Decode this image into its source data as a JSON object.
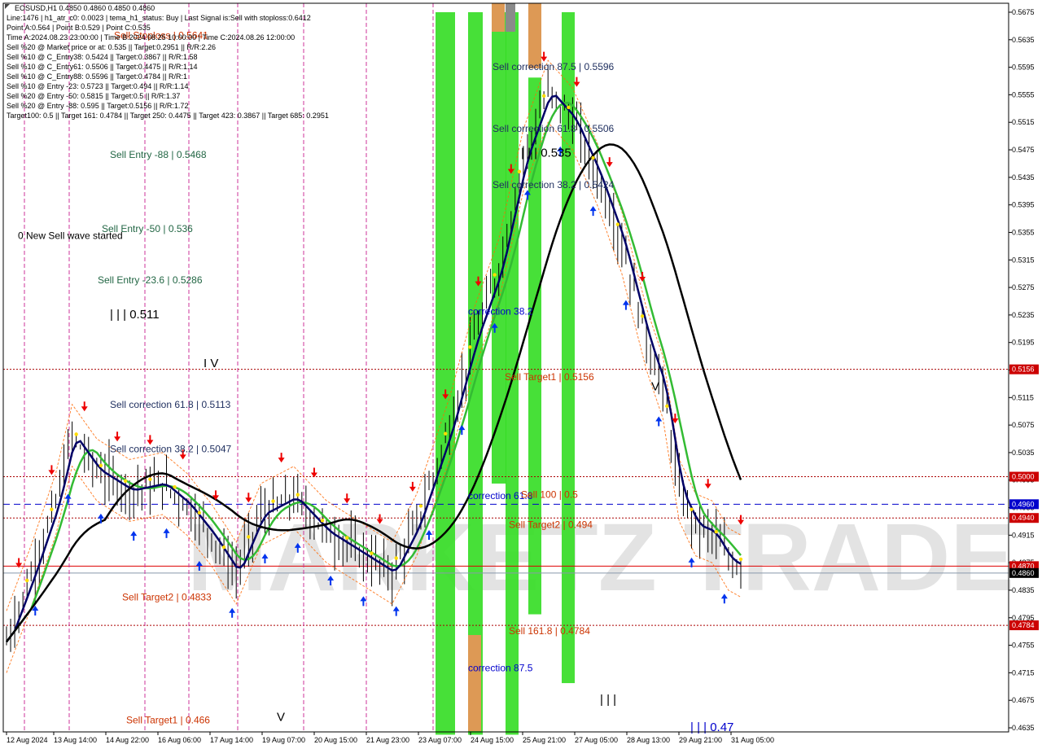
{
  "header": {
    "lines": [
      "EOSUSD,H1  0.4850 0.4860 0.4850 0.4860",
      "Line:1476 | h1_atr_c0: 0.0023 | tema_h1_status: Buy | Last Signal is:Sell with stoploss:0.6412",
      "Point A:0.564 | Point B:0.529 | Point C:0.535",
      "Time A:2024.08.23 23:00:00 | Time B:2024.08.25 10:00:00 | Time C:2024.08.26 12:00:00",
      "Sell %20 @ Market price or at: 0.535 || Target:0.2951 || R/R:2.26",
      "Sell %10 @ C_Entry38: 0.5424 || Target:0.3867 || R/R:1.58",
      "Sell %10 @ C_Entry61: 0.5506 || Target:0.4475 || R/R:1.14",
      "Sell %10 @ C_Entry88: 0.5596 || Target:0.4784 || R/R:1",
      "Sell %10 @ Entry -23: 0.5723 || Target:0.494 || R/R:1.14",
      "Sell %20 @ Entry -50: 0.5815 || Target:0.5 || R/R:1.37",
      "Sell %20 @ Entry -88: 0.595 || Target:0.5156 || R/R:1.72",
      "Target100: 0.5 || Target 161: 0.4784 || Target 250: 0.4475 || Target 423: 0.3867 || Target 685: 0.2951"
    ]
  },
  "watermark": "MARKETZ TRADE",
  "chart_data": {
    "type": "candlestick",
    "symbol": "EOSUSD",
    "timeframe": "H1",
    "ylim": [
      0.4625,
      0.5685
    ],
    "y_ticks": [
      "0.5675",
      "0.5635",
      "0.5595",
      "0.5555",
      "0.5515",
      "0.5475",
      "0.5435",
      "0.5395",
      "0.5355",
      "0.5315",
      "0.5275",
      "0.5235",
      "0.5195",
      "0.5155",
      "0.5115",
      "0.5075",
      "0.5035",
      "0.4995",
      "0.4955",
      "0.4915",
      "0.4875",
      "0.4835",
      "0.4795",
      "0.4755",
      "0.4715",
      "0.4675",
      "0.4635"
    ],
    "x_ticks": [
      "12 Aug 2024",
      "13 Aug 14:00",
      "14 Aug 22:00",
      "16 Aug 06:00",
      "17 Aug 14:00",
      "19 Aug 07:00",
      "20 Aug 15:00",
      "21 Aug 23:00",
      "23 Aug 07:00",
      "24 Aug 15:00",
      "25 Aug 21:00",
      "27 Aug 05:00",
      "28 Aug 13:00",
      "29 Aug 21:00",
      "31 Aug 05:00"
    ],
    "current_price": 0.486,
    "price_tags": [
      {
        "label": "0.5156",
        "value": 0.5156,
        "color": "#cc0000"
      },
      {
        "label": "0.5000",
        "value": 0.5,
        "color": "#cc0000"
      },
      {
        "label": "0.4960",
        "value": 0.496,
        "color": "#0000cc"
      },
      {
        "label": "0.4940",
        "value": 0.494,
        "color": "#cc0000"
      },
      {
        "label": "0.4870",
        "value": 0.487,
        "color": "#cc0000"
      },
      {
        "label": "0.4860",
        "value": 0.486,
        "color": "#000000"
      },
      {
        "label": "0.4784",
        "value": 0.4784,
        "color": "#cc0000"
      }
    ],
    "levels": [
      {
        "value": 0.5156,
        "style": "dotted",
        "color": "#aa0000"
      },
      {
        "value": 0.5,
        "style": "dotted",
        "color": "#aa0000"
      },
      {
        "value": 0.496,
        "style": "dashed",
        "color": "#0000cc"
      },
      {
        "value": 0.494,
        "style": "dotted",
        "color": "#aa0000"
      },
      {
        "value": 0.487,
        "style": "solid",
        "color": "#dd0000"
      },
      {
        "value": 0.486,
        "style": "solid",
        "color": "#8899aa"
      },
      {
        "value": 0.4784,
        "style": "dotted",
        "color": "#aa0000"
      }
    ],
    "vertical_markers_xtick_index": [
      0.3,
      0.8,
      2.5,
      3.3,
      4.4,
      5.5,
      6.0,
      7.5
    ],
    "green_zones": [
      {
        "from": 0.5675,
        "to": 0.4625,
        "col": 0.0
      },
      {
        "from": 0.5675,
        "to": 0.4625,
        "col": 1.0
      },
      {
        "from": 0.5675,
        "to": 0.499,
        "col": 2.0
      },
      {
        "from": 0.5675,
        "to": 0.4625,
        "col": 3.0
      },
      {
        "from": 0.558,
        "to": 0.48,
        "col": 4.0
      },
      {
        "from": 0.5675,
        "to": 0.47,
        "col": 5.0
      }
    ],
    "annotations": [
      {
        "text": "Sell Stoploss | 0.5641",
        "value": 0.5641,
        "color": "#cc3300"
      },
      {
        "text": "Sell correction 87.5 | 0.5596",
        "value": 0.5596,
        "color": "#203060"
      },
      {
        "text": "Sell correction 61.8 | 0.5506",
        "value": 0.5506,
        "color": "#203060"
      },
      {
        "text": "| | | 0.535",
        "value": 0.547,
        "color": "#000000"
      },
      {
        "text": "Sell Entry -88 | 0.5468",
        "value": 0.5468,
        "color": "#226644"
      },
      {
        "text": "Sell correction 38.2 | 0.5424",
        "value": 0.5424,
        "color": "#203060"
      },
      {
        "text": "Sell Entry -50 | 0.536",
        "value": 0.536,
        "color": "#226644"
      },
      {
        "text": "0 New Sell wave started",
        "value": 0.535,
        "color": "#000000"
      },
      {
        "text": "Sell Entry -23.6 | 0.5286",
        "value": 0.5286,
        "color": "#226644"
      },
      {
        "text": "correction 38.2",
        "value": 0.524,
        "color": "#0000cc"
      },
      {
        "text": "| | | 0.511",
        "value": 0.5235,
        "color": "#000000"
      },
      {
        "text": "I V",
        "value": 0.5164,
        "color": "#000000"
      },
      {
        "text": "Sell Target1 | 0.5156",
        "value": 0.5145,
        "color": "#cc3300"
      },
      {
        "text": "V",
        "value": 0.513,
        "color": "#000000"
      },
      {
        "text": "Sell correction 61.8 | 0.5113",
        "value": 0.5105,
        "color": "#203060"
      },
      {
        "text": "Sell correction 38.2 | 0.5047",
        "value": 0.504,
        "color": "#203060"
      },
      {
        "text": "correction 61.8",
        "value": 0.4972,
        "color": "#0000cc"
      },
      {
        "text": "Sell 100 | 0.5",
        "value": 0.4974,
        "color": "#cc3300"
      },
      {
        "text": "Sell Target2 | 0.494",
        "value": 0.493,
        "color": "#cc3300"
      },
      {
        "text": "Sell Target2 | 0.4833",
        "value": 0.4825,
        "color": "#cc3300"
      },
      {
        "text": "Sell 161.8 | 0.4784",
        "value": 0.4776,
        "color": "#cc3300"
      },
      {
        "text": "correction 87.5",
        "value": 0.4722,
        "color": "#0000cc"
      },
      {
        "text": "| | |",
        "value": 0.4675,
        "color": "#000000"
      },
      {
        "text": "Sell Target1 | 0.466",
        "value": 0.4646,
        "color": "#cc3300"
      },
      {
        "text": "V",
        "value": 0.465,
        "color": "#000000"
      },
      {
        "text": "| | | 0.47",
        "value": 0.4635,
        "color": "#0000cc"
      }
    ],
    "series": [
      {
        "name": "",
        "color": "#000066",
        "role": "fast"
      },
      {
        "name": "",
        "color": "#33bb33",
        "role": "mid"
      },
      {
        "name": "",
        "color": "#000000",
        "role": "slow"
      }
    ]
  }
}
